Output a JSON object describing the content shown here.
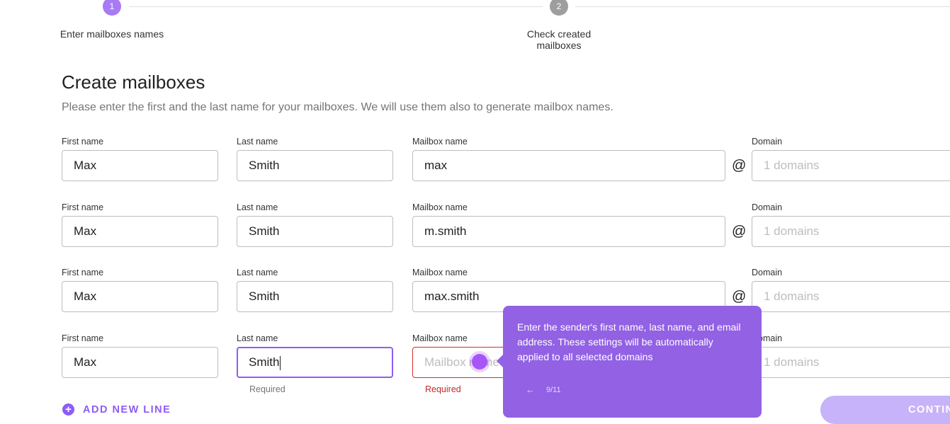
{
  "stepper": {
    "steps": [
      {
        "number": "1",
        "label": "Enter mailboxes names",
        "active": true
      },
      {
        "number": "2",
        "label": "Check created mailboxes",
        "active": false
      }
    ]
  },
  "page": {
    "title": "Create mailboxes",
    "subtitle": "Please enter the first and the last name for your mailboxes. We will use them also to generate mailbox names."
  },
  "labels": {
    "first_name": "First name",
    "last_name": "Last name",
    "mailbox_name": "Mailbox name",
    "domain": "Domain",
    "at": "@"
  },
  "rows": [
    {
      "first_name": "Max",
      "last_name": "Smith",
      "mailbox_name": "max",
      "domain_placeholder": "1 domains"
    },
    {
      "first_name": "Max",
      "last_name": "Smith",
      "mailbox_name": "m.smith",
      "domain_placeholder": "1 domains"
    },
    {
      "first_name": "Max",
      "last_name": "Smith",
      "mailbox_name": "max.smith",
      "domain_placeholder": "1 domains"
    },
    {
      "first_name": "Max",
      "last_name": "Smith",
      "mailbox_name_placeholder": "Mailbox name",
      "domain_placeholder": "1 domains",
      "last_name_helper": "Required",
      "mailbox_name_helper": "Required"
    }
  ],
  "actions": {
    "add_new_line": "ADD NEW LINE",
    "continue": "CONTINUE"
  },
  "tour": {
    "text": "Enter the sender's first name, last name, and email address. These settings will be automatically applied to all selected domains",
    "progress": "9/11",
    "back_icon": "arrow-left-icon"
  },
  "colors": {
    "accent": "#8e5cf5",
    "tooltip_bg": "#9261e4",
    "error": "#d32f2f",
    "step_active": "#a77bf3",
    "step_inactive": "#9e9e9e"
  }
}
